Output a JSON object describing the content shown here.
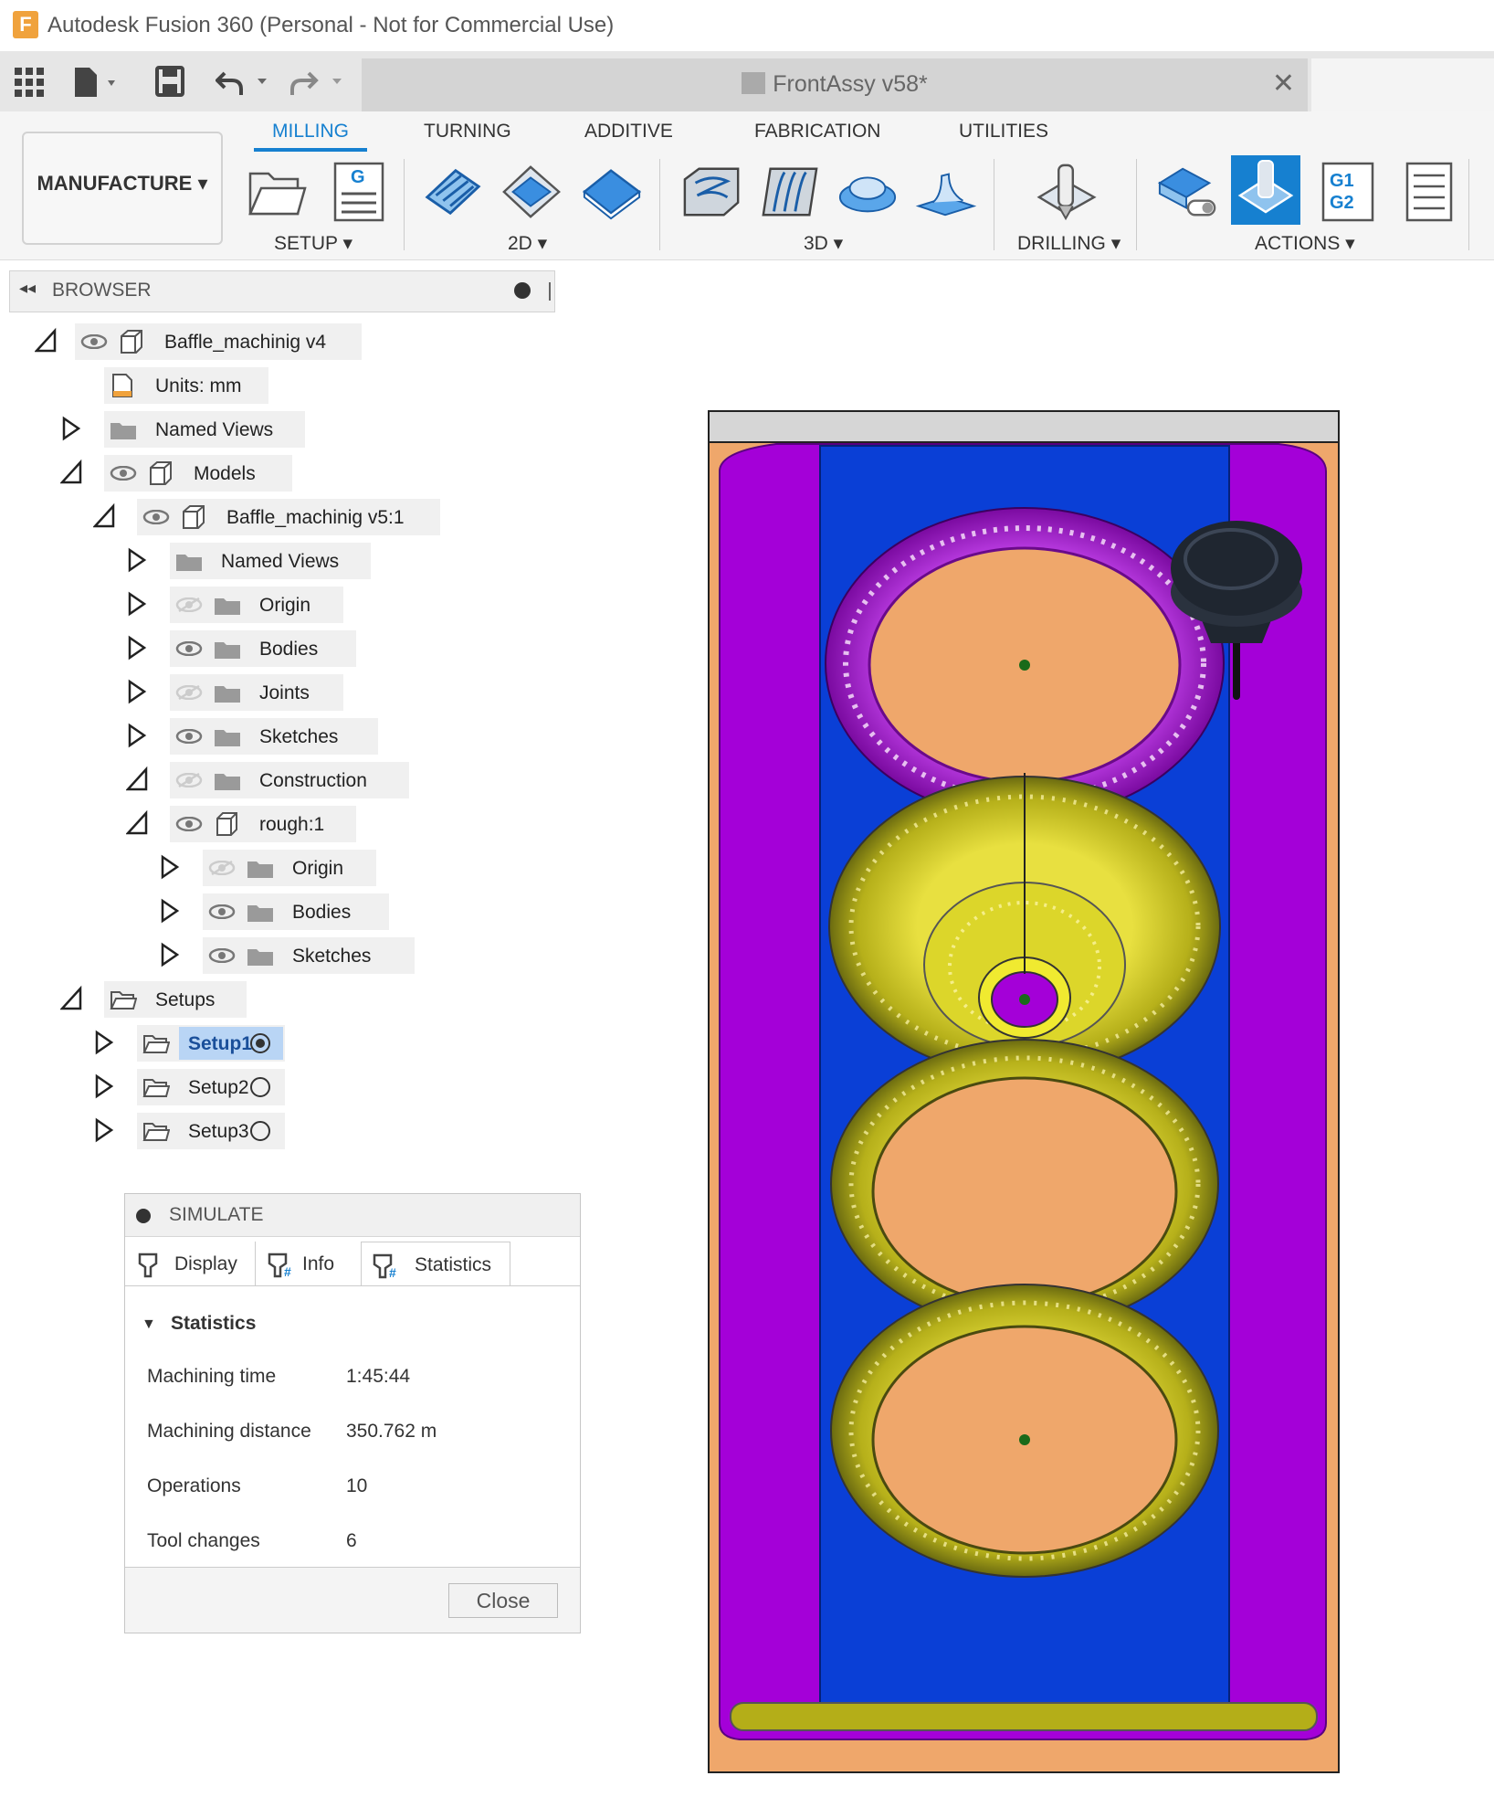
{
  "window": {
    "title": "Autodesk Fusion 360 (Personal - Not for Commercial Use)"
  },
  "document_tab": {
    "title": "FrontAssy v58*"
  },
  "workspace": {
    "label": "MANUFACTURE ▾"
  },
  "ribbon": {
    "tabs": [
      {
        "label": "MILLING",
        "active": true
      },
      {
        "label": "TURNING"
      },
      {
        "label": "ADDITIVE"
      },
      {
        "label": "FABRICATION"
      },
      {
        "label": "UTILITIES"
      }
    ],
    "groups": {
      "setup": "SETUP ▾",
      "two_d": "2D ▾",
      "three_d": "3D ▾",
      "drilling": "DRILLING ▾",
      "actions": "ACTIONS ▾"
    },
    "g_label": "G",
    "g1g2_label": "G1\nG2"
  },
  "browser": {
    "title": "BROWSER",
    "nodes": [
      {
        "label": "Baffle_machinig v4"
      },
      {
        "label": "Units: mm"
      },
      {
        "label": "Named Views"
      },
      {
        "label": "Models"
      },
      {
        "label": "Baffle_machinig v5:1"
      },
      {
        "label": "Named Views"
      },
      {
        "label": "Origin"
      },
      {
        "label": "Bodies"
      },
      {
        "label": "Joints"
      },
      {
        "label": "Sketches"
      },
      {
        "label": "Construction"
      },
      {
        "label": "rough:1"
      },
      {
        "label": "Origin"
      },
      {
        "label": "Bodies"
      },
      {
        "label": "Sketches"
      },
      {
        "label": "Setups"
      },
      {
        "label": "Setup1"
      },
      {
        "label": "Setup2"
      },
      {
        "label": "Setup3"
      }
    ]
  },
  "simulate": {
    "title": "SIMULATE",
    "tabs": [
      "Display",
      "Info",
      "Statistics"
    ],
    "section": "Statistics",
    "stats": [
      {
        "label": "Machining time",
        "value": "1:45:44"
      },
      {
        "label": "Machining distance",
        "value": "350.762 m"
      },
      {
        "label": "Operations",
        "value": "10"
      },
      {
        "label": "Tool changes",
        "value": "6"
      }
    ],
    "close_label": "Close"
  },
  "colors": {
    "accent": "#1680d0",
    "part_purple": "#a400d8",
    "part_blue": "#0a3fd6",
    "stock_orange": "#efa76b",
    "toolpath_yellow": "#c8c220"
  }
}
